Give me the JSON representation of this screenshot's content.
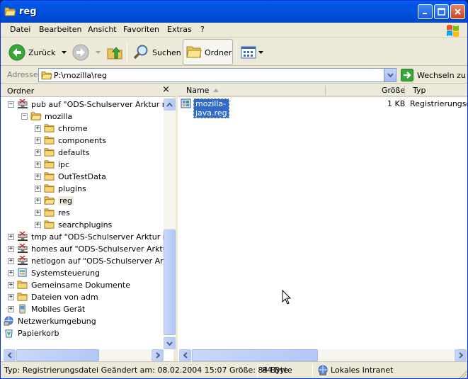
{
  "window": {
    "title": "reg"
  },
  "menu": [
    "Datei",
    "Bearbeiten",
    "Ansicht",
    "Favoriten",
    "Extras",
    "?"
  ],
  "toolbar": {
    "back_label": "Zurück",
    "search_label": "Suchen",
    "folders_label": "Ordner"
  },
  "address": {
    "label": "Adresse",
    "value": "P:\\mozilla\\reg",
    "go_label": "Wechseln zu"
  },
  "folders_pane": {
    "title": "Ordner",
    "close": "×",
    "tree": [
      {
        "label": "pub auf \"ODS-Schulserver Arktur mit S",
        "icon": "network-drive-icon",
        "expander": "−",
        "indent": 0
      },
      {
        "label": "mozilla",
        "icon": "folder-open-icon",
        "expander": "−",
        "indent": 1
      },
      {
        "label": "chrome",
        "icon": "folder-icon",
        "expander": "+",
        "indent": 2
      },
      {
        "label": "components",
        "icon": "folder-icon",
        "expander": "+",
        "indent": 2
      },
      {
        "label": "defaults",
        "icon": "folder-icon",
        "expander": "+",
        "indent": 2
      },
      {
        "label": "ipc",
        "icon": "folder-icon",
        "expander": "+",
        "indent": 2
      },
      {
        "label": "OutTestData",
        "icon": "folder-icon",
        "expander": "+",
        "indent": 2
      },
      {
        "label": "plugins",
        "icon": "folder-icon",
        "expander": "+",
        "indent": 2
      },
      {
        "label": "reg",
        "icon": "folder-open-icon",
        "expander": "+",
        "indent": 2,
        "selected": true
      },
      {
        "label": "res",
        "icon": "folder-icon",
        "expander": "+",
        "indent": 2
      },
      {
        "label": "searchplugins",
        "icon": "folder-icon",
        "expander": "+",
        "indent": 2
      },
      {
        "label": "tmp auf \"ODS-Schulserver Arktur mit S",
        "icon": "network-drive-icon",
        "expander": "+",
        "indent": 0
      },
      {
        "label": "homes auf \"ODS-Schulserver Arktur mi",
        "icon": "network-drive-icon",
        "expander": "+",
        "indent": 0
      },
      {
        "label": "netlogon auf \"ODS-Schulserver Arktur",
        "icon": "network-drive-icon",
        "expander": "+",
        "indent": 0
      },
      {
        "label": "Systemsteuerung",
        "icon": "control-panel-icon",
        "expander": "+",
        "indent": 0
      },
      {
        "label": "Gemeinsame Dokumente",
        "icon": "folder-icon",
        "expander": "+",
        "indent": 0
      },
      {
        "label": "Dateien von adm",
        "icon": "folder-icon",
        "expander": "+",
        "indent": 0
      },
      {
        "label": "Mobiles Gerät",
        "icon": "mobile-device-icon",
        "expander": "+",
        "indent": 0
      },
      {
        "label": "Netzwerkumgebung",
        "icon": "network-places-icon",
        "expander": "",
        "indent": -1
      },
      {
        "label": "Papierkorb",
        "icon": "recycle-bin-icon",
        "expander": "",
        "indent": -1
      }
    ]
  },
  "file_list": {
    "columns": [
      "Name",
      "Größe",
      "Typ"
    ],
    "rows": [
      {
        "name": "mozilla-java.reg",
        "size": "1 KB",
        "type": "Registrierungsda",
        "icon": "reg-file-icon"
      }
    ]
  },
  "status": {
    "info": "Typ: Registrierungsdatei Geändert am: 08.02.2004 15:07 Größe: 84 Byte",
    "size": "84 Byte",
    "zone": "Lokales Intranet"
  },
  "colors": {
    "titlebar": "#0054e3",
    "selection": "#316ac5",
    "chrome": "#ece9d8"
  }
}
